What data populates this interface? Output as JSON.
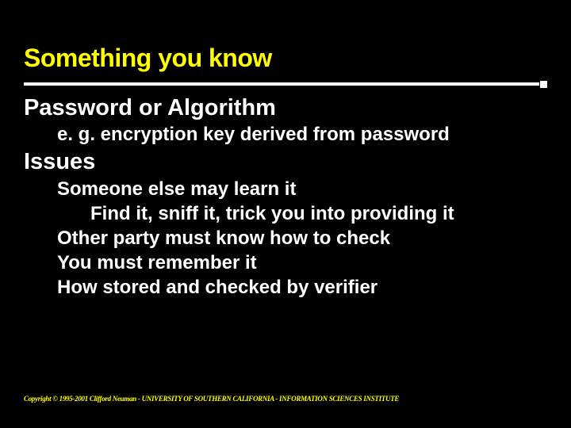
{
  "slide": {
    "title": "Something you know",
    "heading": "Password or Algorithm",
    "lines": {
      "a": "e. g. encryption key derived from password",
      "b": "Issues",
      "c": "Someone else may learn it",
      "d": "Find it, sniff it, trick you into providing it",
      "e": "Other party must know how to check",
      "f": "You must remember it",
      "g": "How stored and checked by verifier"
    },
    "footer": "Copyright © 1995-2001 Clifford Neuman - UNIVERSITY OF SOUTHERN CALIFORNIA - INFORMATION SCIENCES INSTITUTE"
  }
}
